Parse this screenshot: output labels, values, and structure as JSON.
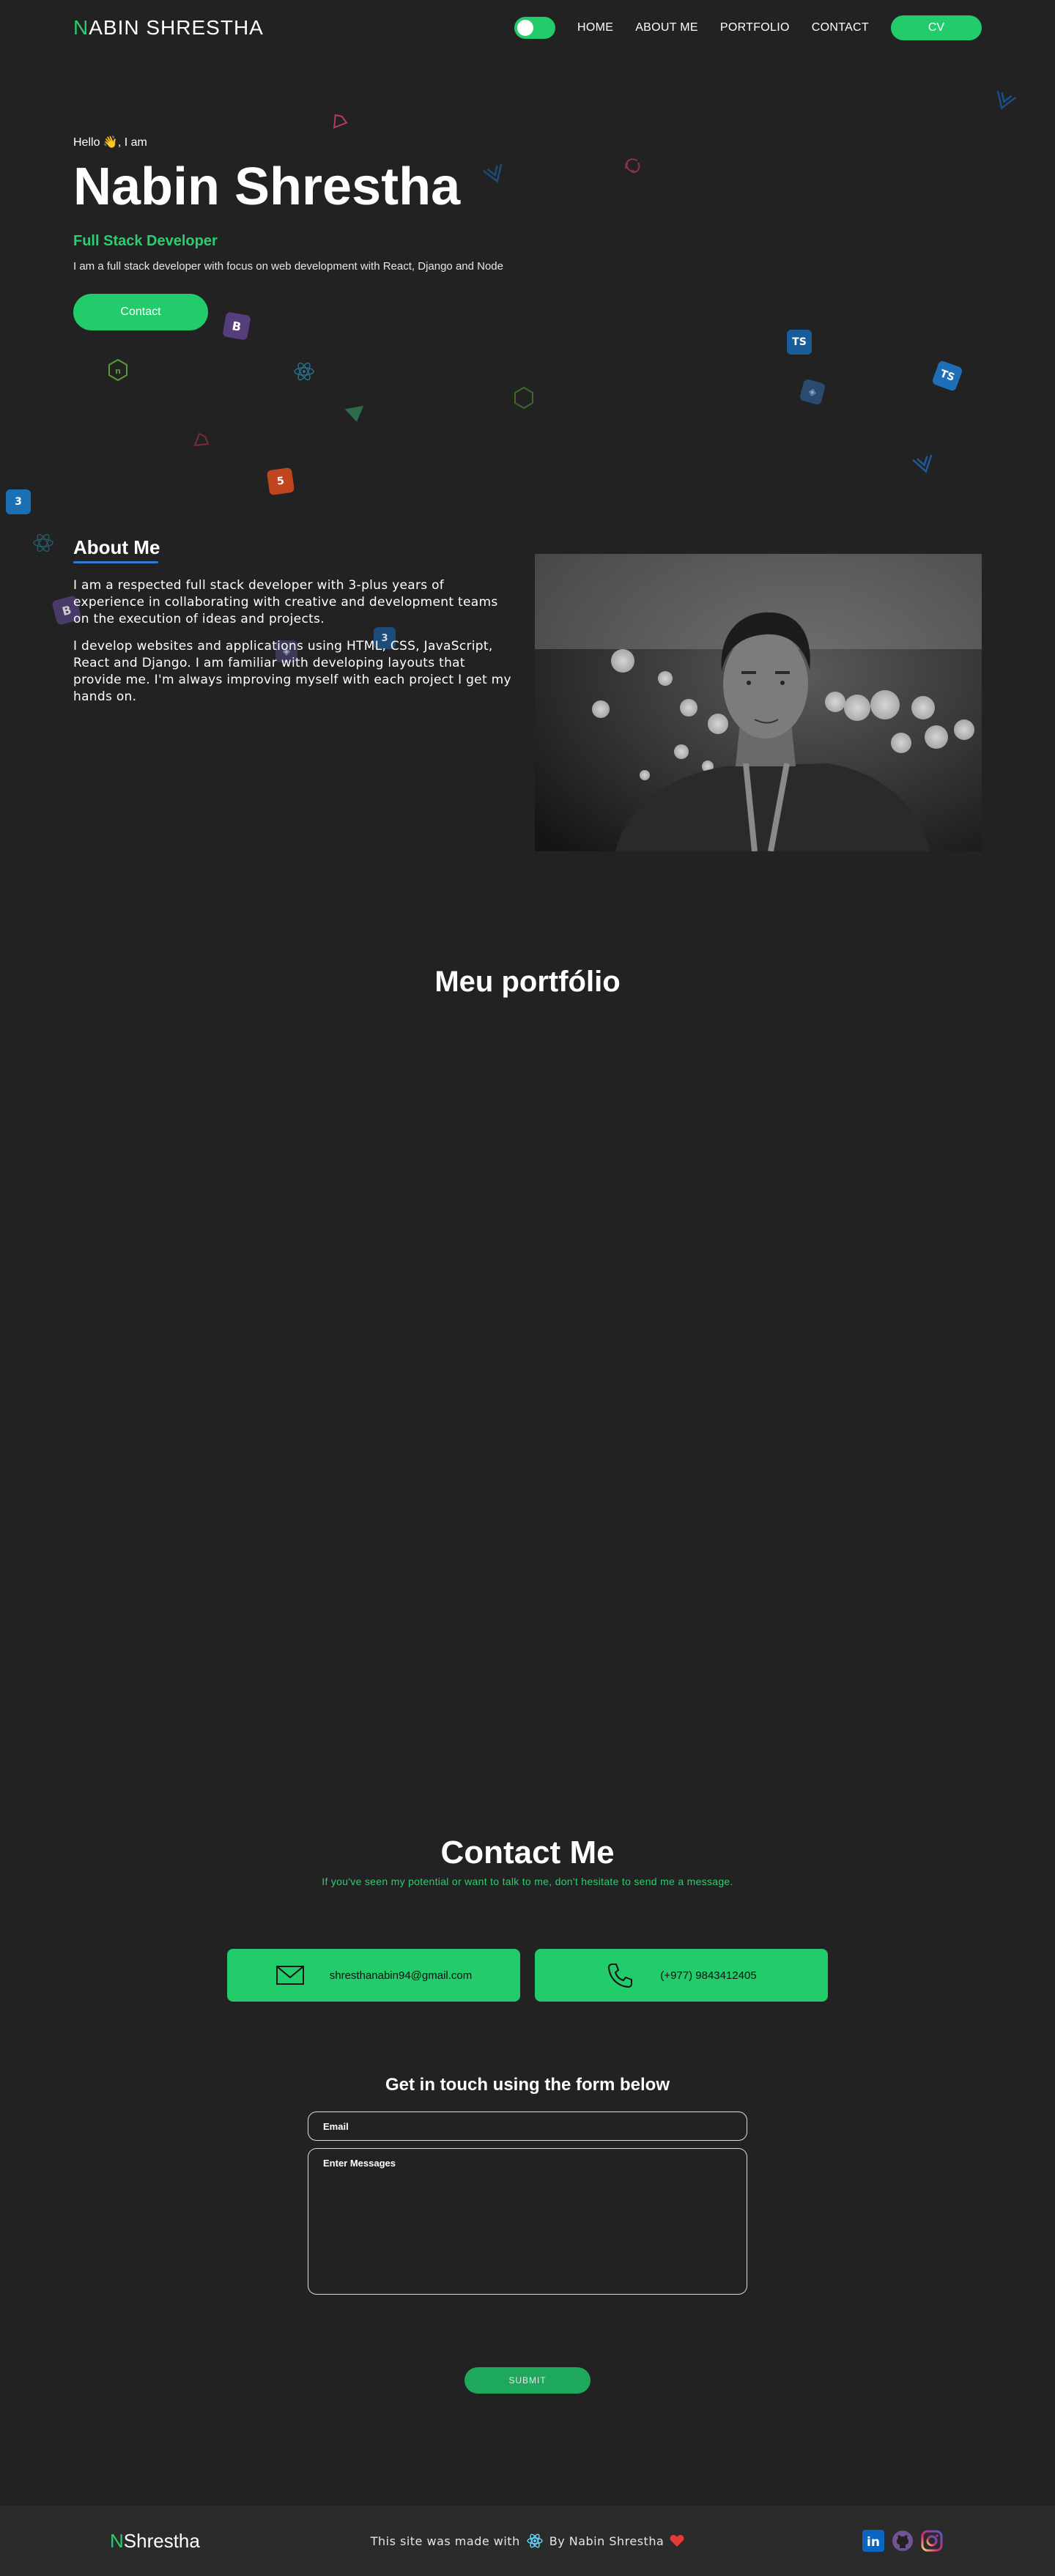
{
  "nav": {
    "logo_first": "N",
    "logo_rest": "ABIN SHRESTHA",
    "links": [
      "HOME",
      "ABOUT ME",
      "PORTFOLIO",
      "CONTACT"
    ],
    "cv_label": "CV",
    "theme_toggle": "on"
  },
  "hero": {
    "greeting": "Hello 👋, I am",
    "name": "Nabin Shrestha",
    "role": "Full Stack Developer",
    "description": "I am a full stack developer with focus on web development with React, Django and Node",
    "contact_label": "Contact"
  },
  "floating_icons": {
    "ts_label": "TS",
    "bootstrap_label": "B",
    "icon_names": [
      "react-icon",
      "typescript-icon",
      "bootstrap-icon",
      "node-icon",
      "vue-icon",
      "webpack-icon",
      "redux-icon",
      "laravel-icon",
      "django-icon"
    ]
  },
  "about": {
    "title": "About Me",
    "paragraphs": [
      "I am a respected full stack developer with 3-plus years of experience in collaborating with creative and development teams on the execution of ideas and projects.",
      "I develop websites and applications using HTML, CSS, JavaScript, React and Django. I am familiar with developing layouts that provide me. I'm always improving myself with each project I get my hands on."
    ]
  },
  "portfolio": {
    "title": "Meu portfólio"
  },
  "contact": {
    "title": "Contact Me",
    "subtitle": "If you've seen my potential or want to talk to me, don't hesitate to send me a message.",
    "email": "shresthanabin94@gmail.com",
    "phone": "(+977) 9843412405",
    "form_title": "Get in touch using the form below",
    "email_placeholder": "Email",
    "message_placeholder": "Enter Messages",
    "submit_label": "SUBMIT"
  },
  "footer": {
    "logo_first": "N",
    "logo_rest": "Shrestha",
    "made_with_before": "This site was made with",
    "made_with_after": "By Nabin Shrestha",
    "socials": [
      "linkedin-icon",
      "github-icon",
      "instagram-icon"
    ]
  },
  "colors": {
    "background": "#222222",
    "accent": "#22cc6a",
    "underline": "#2f7bd8",
    "footer_bg": "#2b2b2b"
  }
}
